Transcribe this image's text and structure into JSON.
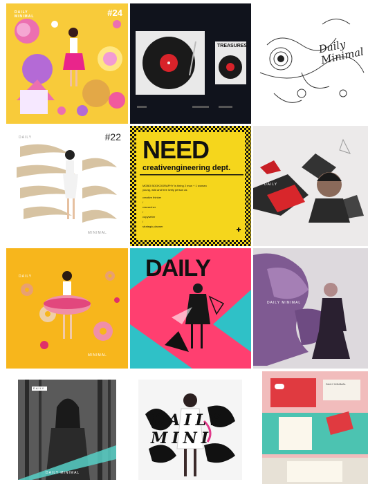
{
  "tiles": {
    "t1": {
      "brand": "DAILY\nMINIMAL",
      "number": "#24"
    },
    "t2": {
      "label": "TREASURES"
    },
    "t3": {
      "title": "Daily\nMinimal"
    },
    "t4": {
      "brand": "DAILY",
      "number": "#22",
      "footer": "MINIMAL"
    },
    "t5": {
      "headline": "NEED",
      "subhead": "creativengineering dept.",
      "body": "MOBO BOOKOGRAPHY is hiring 2 man + 1 woman\nyoung, wild and free lively person as",
      "roles": [
        "creative thinker",
        "/",
        "researcher",
        "/",
        "copywriter",
        "/",
        "strategic planner"
      ]
    },
    "t6": {
      "brand": "DAILY"
    },
    "t7": {
      "brand": "DAILY",
      "footer": "MINIMAL"
    },
    "t8": {
      "headline": "DAILY"
    },
    "t9": {
      "brand": "DAILY MINIMAL"
    },
    "t10": {
      "tag": "DAILY",
      "brand": "DAILY MINIMAL"
    },
    "t11": {
      "script": "DAILY\nMINI"
    },
    "t12": {
      "label": "DAILY MINIMAL"
    }
  }
}
